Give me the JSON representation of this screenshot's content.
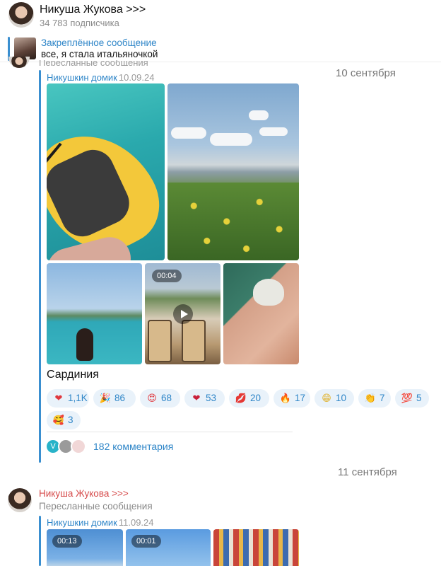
{
  "header": {
    "title": "Никуша Жукова >>>",
    "subscribers": "34 783 подписчика",
    "avatar_icon": "channel-avatar"
  },
  "pinned": {
    "title": "Закреплённое сообщение",
    "text": "все, я стала итальяночкой"
  },
  "post1": {
    "date_separator": "10 сентября",
    "forwarded_from": "Никушкин домик",
    "forwarded_date": "10.09.24",
    "video_duration": "00:04",
    "caption": "Сардиния",
    "reactions": [
      {
        "emoji": "❤",
        "count": "1,1K",
        "color": "#e0383e"
      },
      {
        "emoji": "🎉",
        "count": "86",
        "color": "#d98a2b"
      },
      {
        "emoji": "😍",
        "count": "68",
        "color": "#e0383e"
      },
      {
        "emoji": "❤",
        "count": "53",
        "color": "#c9203a"
      },
      {
        "emoji": "💋",
        "count": "20",
        "color": "#e0383e"
      },
      {
        "emoji": "🔥",
        "count": "17",
        "color": "#f07a1a"
      },
      {
        "emoji": "😁",
        "count": "10",
        "color": "#e0b12a"
      },
      {
        "emoji": "👏",
        "count": "7",
        "color": "#e7b642"
      },
      {
        "emoji": "💯",
        "count": "5",
        "color": "#e0383e"
      },
      {
        "emoji": "🥰",
        "count": "3",
        "color": "#e08a2a"
      }
    ],
    "comments_label": "182 комментария"
  },
  "post2": {
    "date_separator": "11 сентября",
    "sender": "Никуша Жукова >>>",
    "forwarded_label": "Пересланные сообщения",
    "forwarded_from": "Никушкин домик",
    "forwarded_date": "11.09.24",
    "video_durations": [
      "00:13",
      "00:01"
    ]
  }
}
